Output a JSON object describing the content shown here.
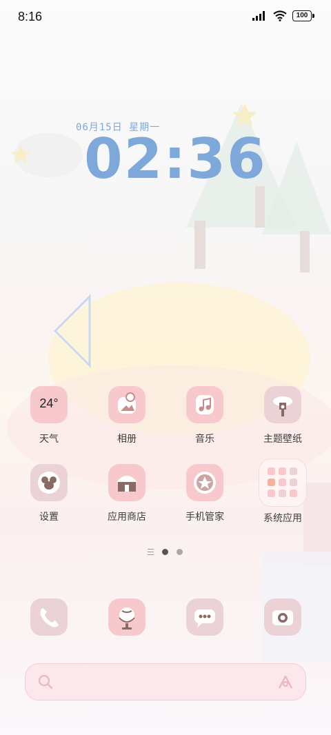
{
  "status_bar": {
    "time": "8:16",
    "battery": "100",
    "icons": [
      "signal-icon",
      "wifi-icon",
      "battery-icon"
    ]
  },
  "clock": {
    "date": "06月15日 星期一",
    "time": "02:36",
    "color": "#7ea7da"
  },
  "apps": [
    {
      "label": "天气",
      "icon": "weather-icon",
      "temp": "24°"
    },
    {
      "label": "相册",
      "icon": "photos-icon"
    },
    {
      "label": "音乐",
      "icon": "music-icon"
    },
    {
      "label": "主题壁纸",
      "icon": "themes-icon"
    },
    {
      "label": "设置",
      "icon": "settings-icon"
    },
    {
      "label": "应用商店",
      "icon": "app-store-icon"
    },
    {
      "label": "手机管家",
      "icon": "phone-manager-icon"
    },
    {
      "label": "系统应用",
      "icon": "system-apps-folder-icon"
    }
  ],
  "page_indicator": {
    "pages": 2,
    "active": 1
  },
  "dock": [
    {
      "icon": "phone-icon"
    },
    {
      "icon": "browser-icon"
    },
    {
      "icon": "messages-icon"
    },
    {
      "icon": "camera-icon"
    }
  ],
  "search": {
    "icons": [
      "search-icon",
      "assistant-icon"
    ]
  },
  "colors": {
    "pink_tile": "#f7c9cd",
    "mauve_tile": "#ead2d6",
    "search_bg": "#fbe7ec"
  }
}
